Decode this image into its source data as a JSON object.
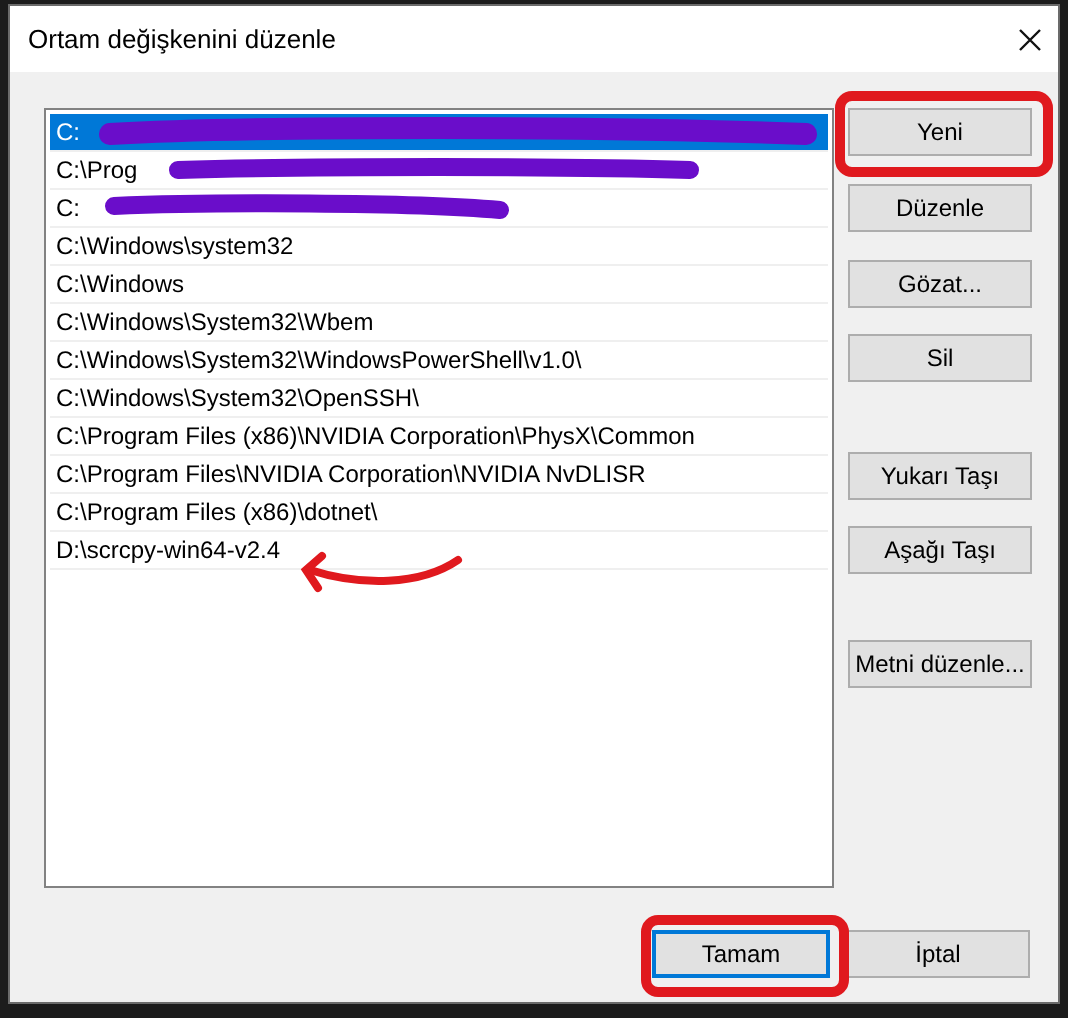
{
  "window": {
    "title": "Ortam değişkenini düzenle"
  },
  "paths": [
    {
      "text": "C:",
      "selected": true
    },
    {
      "text": "C:\\Prog",
      "selected": false
    },
    {
      "text": "C:",
      "selected": false
    },
    {
      "text": "C:\\Windows\\system32",
      "selected": false
    },
    {
      "text": "C:\\Windows",
      "selected": false
    },
    {
      "text": "C:\\Windows\\System32\\Wbem",
      "selected": false
    },
    {
      "text": "C:\\Windows\\System32\\WindowsPowerShell\\v1.0\\",
      "selected": false
    },
    {
      "text": "C:\\Windows\\System32\\OpenSSH\\",
      "selected": false
    },
    {
      "text": "C:\\Program Files (x86)\\NVIDIA Corporation\\PhysX\\Common",
      "selected": false
    },
    {
      "text": "C:\\Program Files\\NVIDIA Corporation\\NVIDIA NvDLISR",
      "selected": false
    },
    {
      "text": "C:\\Program Files (x86)\\dotnet\\",
      "selected": false
    },
    {
      "text": "D:\\scrcpy-win64-v2.4",
      "selected": false
    }
  ],
  "side_buttons": [
    "Yeni",
    "Düzenle",
    "Gözat...",
    "Sil",
    "Yukarı Taşı",
    "Aşağı Taşı",
    "Metni düzenle..."
  ],
  "footer_buttons": [
    {
      "label": "Tamam",
      "default": true
    },
    {
      "label": "İptal",
      "default": false
    }
  ]
}
